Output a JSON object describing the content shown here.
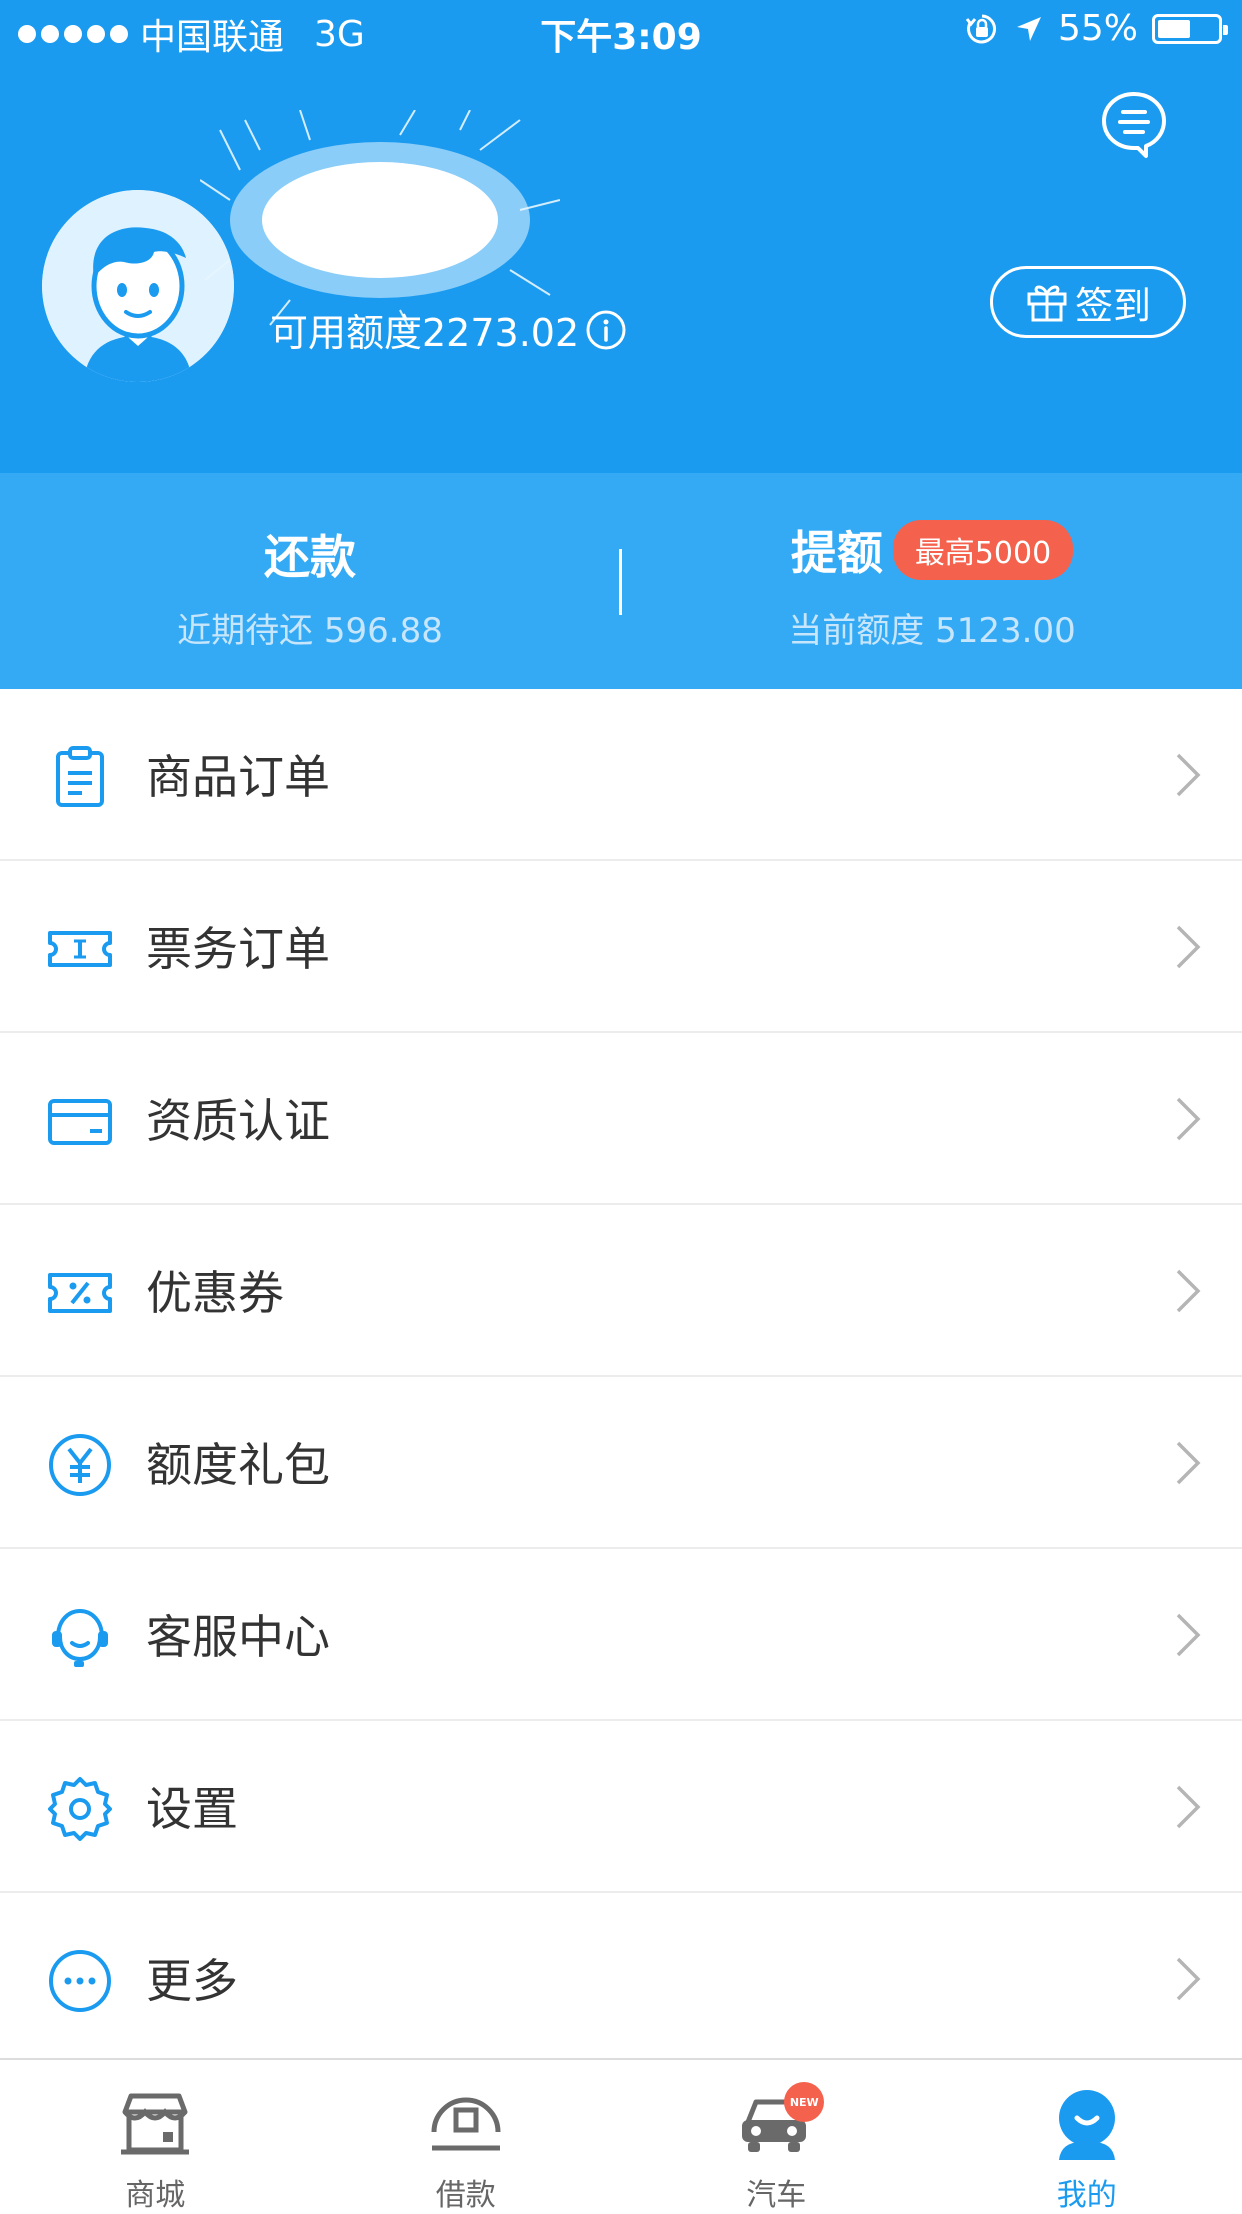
{
  "status_bar": {
    "carrier": "中国联通",
    "network": "3G",
    "time": "下午3:09",
    "battery": "55%",
    "battery_level": 0.55
  },
  "header": {
    "credit_text": "可用额度2273.02",
    "signin_label": "签到",
    "background_color": "#1a9bf0"
  },
  "summary": {
    "repay": {
      "title": "还款",
      "subtitle": "近期待还 596.88"
    },
    "raise": {
      "title": "提额",
      "badge": "最高5000",
      "subtitle": "当前额度 5123.00"
    }
  },
  "menu": {
    "items": [
      {
        "label": "商品订单",
        "icon": "clipboard-icon"
      },
      {
        "label": "票务订单",
        "icon": "ticket-icon"
      },
      {
        "label": "资质认证",
        "icon": "id-card-icon"
      },
      {
        "label": "优惠券",
        "icon": "coupon-icon"
      },
      {
        "label": "额度礼包",
        "icon": "yen-icon"
      },
      {
        "label": "客服中心",
        "icon": "headset-icon"
      },
      {
        "label": "设置",
        "icon": "gear-icon"
      },
      {
        "label": "更多",
        "icon": "more-icon"
      }
    ]
  },
  "tabbar": {
    "tabs": [
      {
        "label": "商城",
        "icon": "store-icon"
      },
      {
        "label": "借款",
        "icon": "loan-icon"
      },
      {
        "label": "汽车",
        "icon": "car-icon",
        "badge": "NEW"
      },
      {
        "label": "我的",
        "icon": "profile-icon",
        "active": true
      }
    ]
  },
  "colors": {
    "primary": "#1a9bf0",
    "accent_red": "#f4614d"
  }
}
